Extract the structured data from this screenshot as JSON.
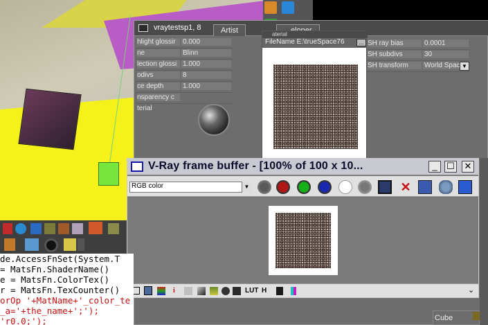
{
  "viewport": {
    "colors": {
      "yellow": "#f4f21a",
      "purple": "#b85cc6",
      "dark_cube": "#3a2836",
      "green_cube": "#76e53c"
    }
  },
  "material_window": {
    "title": "vraytestsp1, 8",
    "tabs": [
      "Artist",
      "eloper"
    ],
    "properties": [
      {
        "label": "hlight  glossir",
        "value": "0.000"
      },
      {
        "label": "ne",
        "value": "Blinn"
      },
      {
        "label": "lection  glossi",
        "value": "1.000"
      },
      {
        "label": "odivs",
        "value": "8"
      },
      {
        "label": "ce  depth",
        "value": "1.000"
      },
      {
        "label": "nsparency  c",
        "value": ""
      },
      {
        "label": "terial",
        "value": ""
      }
    ],
    "sh_properties": [
      {
        "label": "SH  ray  bias",
        "value": "0.0001"
      },
      {
        "label": "SH  subdivs",
        "value": "30"
      },
      {
        "label": "SH  transform",
        "value": "World Space"
      }
    ],
    "sh_dropdown_icon": "chevron-down-icon"
  },
  "texture_panel": {
    "header": "aterial",
    "file_label": "FileName",
    "file_value": "E:\\trueSpace76",
    "browse_label": "..."
  },
  "vfb": {
    "title": "V-Ray frame buffer - [100% of 100 x 10...",
    "channel_select": "RGB color",
    "buttons": {
      "minimize": "_",
      "maximize": "☐",
      "close": "✕"
    },
    "bottom_labels": {
      "info": "i",
      "lut": "LUT",
      "h": "H"
    },
    "colors": {
      "red_channel": "#b01818",
      "green_channel": "#18b018",
      "blue_channel": "#1828b0"
    }
  },
  "code": {
    "lines": [
      {
        "text": "de.AccessFnSet(System.T",
        "color": "black"
      },
      {
        "text": "= MatsFn.ShaderName()",
        "color": "black"
      },
      {
        "text": "e = MatsFn.ColorTex()",
        "color": "black"
      },
      {
        "text": "r = MatsFn.TexCounter()",
        "color": "black"
      },
      {
        "text": "orOp '+MatName+'_color_te",
        "color": "red"
      },
      {
        "text": "_a='+the_name+';');",
        "color": "red"
      },
      {
        "text": "'r0.0;');",
        "color": "red"
      }
    ]
  },
  "cube_tab": {
    "label": "Cube"
  }
}
